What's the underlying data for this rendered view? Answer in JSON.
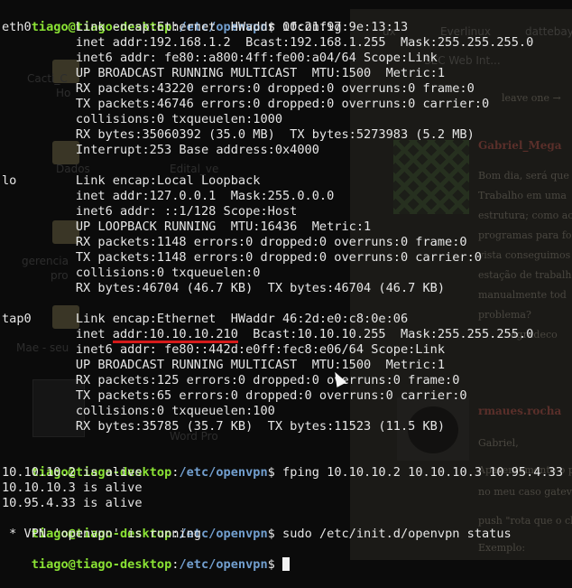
{
  "terminal": {
    "prompt": {
      "user_host": "tiago@tiago-desktop",
      "separator": ":",
      "path": "/etc/openvpn",
      "symbol": "$"
    },
    "command1": " ifconfig",
    "eth0": [
      "eth0      Link encap:Ethernet  HWaddr 00:21:97:9e:13:13",
      "          inet addr:192.168.1.2  Bcast:192.168.1.255  Mask:255.255.255.0",
      "          inet6 addr: fe80::a800:4ff:fe00:a04/64 Scope:Link",
      "          UP BROADCAST RUNNING MULTICAST  MTU:1500  Metric:1",
      "          RX packets:43220 errors:0 dropped:0 overruns:0 frame:0",
      "          TX packets:46746 errors:0 dropped:0 overruns:0 carrier:0",
      "          collisions:0 txqueuelen:1000",
      "          RX bytes:35060392 (35.0 MB)  TX bytes:5273983 (5.2 MB)",
      "          Interrupt:253 Base address:0x4000"
    ],
    "lo": [
      "lo        Link encap:Local Loopback",
      "          inet addr:127.0.0.1  Mask:255.0.0.0",
      "          inet6 addr: ::1/128 Scope:Host",
      "          UP LOOPBACK RUNNING  MTU:16436  Metric:1",
      "          RX packets:1148 errors:0 dropped:0 overruns:0 frame:0",
      "          TX packets:1148 errors:0 dropped:0 overruns:0 carrier:0",
      "          collisions:0 txqueuelen:0",
      "          RX bytes:46704 (46.7 KB)  TX bytes:46704 (46.7 KB)"
    ],
    "tap0": {
      "header": "tap0      Link encap:Ethernet  HWaddr 46:2d:e0:c8:0e:06",
      "inet_prefix": "          inet ",
      "inet_addr": "addr:10.10.10.210",
      "inet_suffix": "  Bcast:10.10.10.255  Mask:255.255.255.0",
      "lines": [
        "          inet6 addr: fe80::442d:e0ff:fec8:e06/64 Scope:Link",
        "          UP BROADCAST RUNNING MULTICAST  MTU:1500  Metric:1",
        "          RX packets:125 errors:0 dropped:0 overruns:0 frame:0",
        "          TX packets:65 errors:0 dropped:0 overruns:0 carrier:0",
        "          collisions:0 txqueuelen:100",
        "          RX bytes:35785 (35.7 KB)  TX bytes:11523 (11.5 KB)"
      ]
    },
    "command2": " fping 10.10.10.2 10.10.10.3 10.95.4.33",
    "fping_output": [
      "10.10.10.2 is alive",
      "10.10.10.3 is alive",
      "10.95.4.33 is alive"
    ],
    "command3": " sudo /etc/init.d/openvpn status",
    "status_output": " * VPN 'openvpn' is running"
  },
  "background": {
    "desktop_labels": [
      "Cacti_C",
      "Ho",
      "Dados",
      "Edital_ve",
      "gerencia",
      "pro",
      "Mae - seu",
      "Word Pro"
    ],
    "tabs": [
      "ux",
      "Everlinux",
      "dattebay",
      "SEC Web Int..."
    ],
    "web_lines": [
      "leave one →",
      "Gabriel_Mega",
      "Bom dia, será que",
      "Trabalho em uma",
      "estrutura; como ac",
      "programas para fo",
      "vista conseguimos",
      "estação de trabalh",
      "manualmente tod",
      "problema?",
      "agradeco",
      "rmaues.rocha",
      "Gabriel,",
      "Aparentemente o p",
      "no meu caso gatev",
      "push \"rota que o cl",
      "Exemplo:"
    ],
    "colors": {
      "user_host": "#8ae234",
      "path": "#729fcf",
      "underline": "#d51a1a",
      "text": "#e6e6e6"
    }
  }
}
